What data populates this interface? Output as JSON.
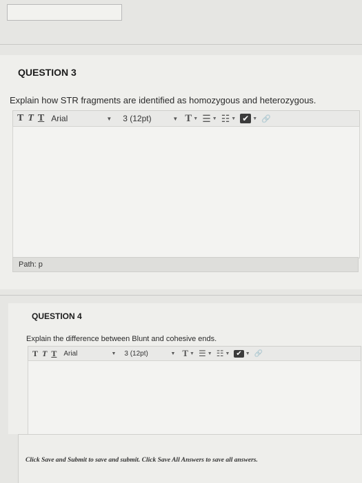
{
  "question3": {
    "title": "QUESTION 3",
    "text": "Explain how STR fragments are identified as homozygous and heterozygous.",
    "toolbar": {
      "bold": "T",
      "italic": "T",
      "underline": "T",
      "font": "Arial",
      "size": "3 (12pt)",
      "arrow": "▼"
    },
    "path_label": "Path: p"
  },
  "question4": {
    "title": "QUESTION 4",
    "text": "Explain the difference between Blunt and cohesive ends.",
    "toolbar": {
      "bold": "T",
      "italic": "T",
      "underline": "T",
      "font": "Arial",
      "size": "3 (12pt)",
      "arrow": "▼"
    }
  },
  "footer": {
    "text": "Click Save and Submit to save and submit. Click Save All Answers to save all answers."
  },
  "icons": {
    "text_color": "T",
    "dropdown": "▼",
    "bullets": "☰",
    "numbers": "☷",
    "spellcheck": "✔",
    "link": "🔗"
  }
}
